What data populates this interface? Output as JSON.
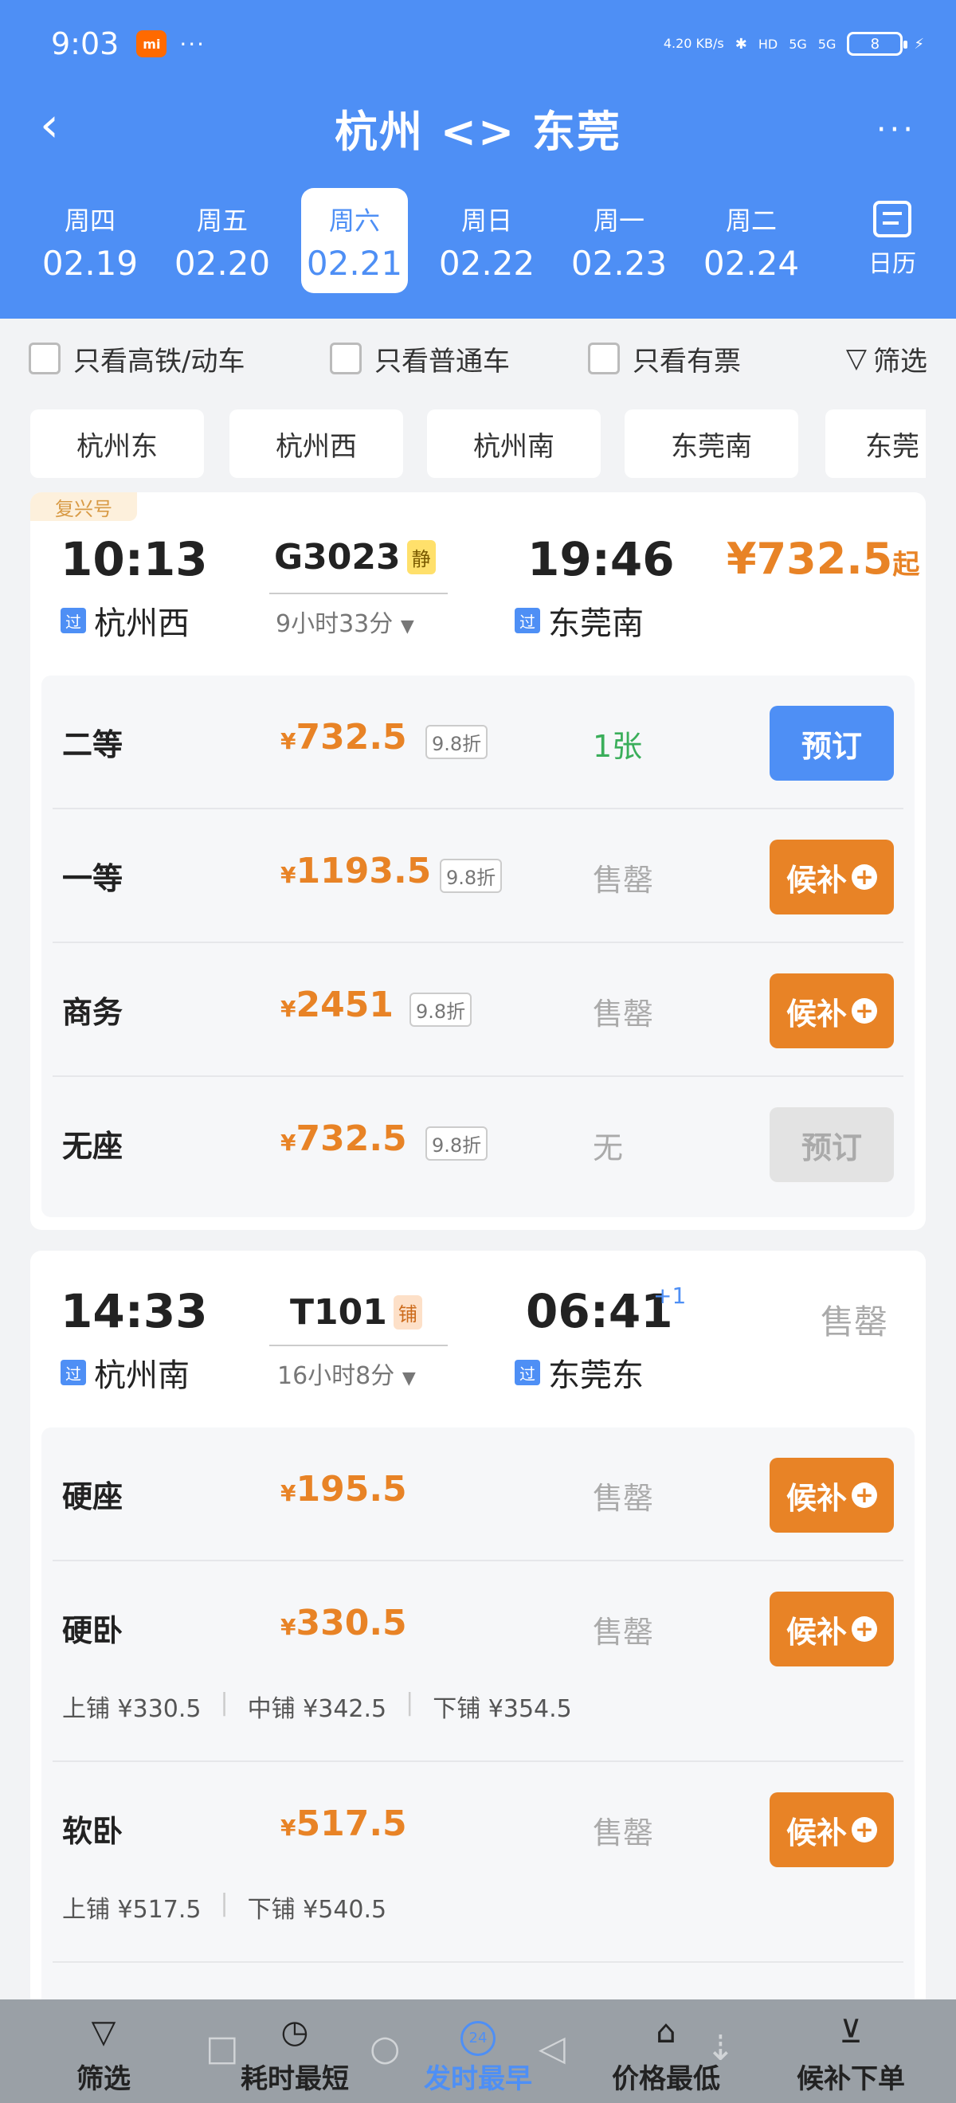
{
  "status": {
    "time": "9:03",
    "mi": "mi",
    "dots": "···",
    "net": "4.20 KB/s",
    "hd": "HD",
    "sig1": "5G",
    "sig2": "5G",
    "battery": "8"
  },
  "header": {
    "title": "杭州 <> 东莞",
    "back": "‹",
    "more": "···"
  },
  "dates": [
    {
      "wd": "周四",
      "dt": "02.19"
    },
    {
      "wd": "周五",
      "dt": "02.20"
    },
    {
      "wd": "周六",
      "dt": "02.21"
    },
    {
      "wd": "周日",
      "dt": "02.22"
    },
    {
      "wd": "周一",
      "dt": "02.23"
    },
    {
      "wd": "周二",
      "dt": "02.24"
    }
  ],
  "calendar_label": "日历",
  "filters": {
    "gaotie": "只看高铁/动车",
    "putong": "只看普通车",
    "youpiao": "只看有票",
    "shaixuan": "筛选"
  },
  "stations": [
    "杭州东",
    "杭州西",
    "杭州南",
    "东莞南",
    "东莞"
  ],
  "trains": [
    {
      "tag": "复兴号",
      "dep_time": "10:13",
      "dep_station": "杭州西",
      "guo": "过",
      "train_no": "G3023",
      "badge": "静",
      "duration": "9小时33分",
      "arr_time": "19:46",
      "arr_station": "东莞南",
      "from_price": "¥732.5",
      "from_suffix": "起",
      "seats": [
        {
          "name": "二等",
          "price": "732.5",
          "disc": "9.8折",
          "avail": "1张",
          "action": "预订"
        },
        {
          "name": "一等",
          "price": "1193.5",
          "disc": "9.8折",
          "avail": "售罄",
          "action": "候补"
        },
        {
          "name": "商务",
          "price": "2451",
          "disc": "9.8折",
          "avail": "售罄",
          "action": "候补"
        },
        {
          "name": "无座",
          "price": "732.5",
          "disc": "9.8折",
          "avail": "无",
          "action": "预订"
        }
      ]
    },
    {
      "dep_time": "14:33",
      "dep_station": "杭州南",
      "guo": "过",
      "train_no": "T101",
      "badge": "铺",
      "duration": "16小时8分",
      "arr_time": "06:41",
      "arr_plus": "+1",
      "arr_station": "东莞东",
      "status": "售罄",
      "seats": [
        {
          "name": "硬座",
          "price": "195.5",
          "avail": "售罄",
          "action": "候补"
        },
        {
          "name": "硬卧",
          "price": "330.5",
          "avail": "售罄",
          "action": "候补",
          "berths": [
            "上铺 ¥330.5",
            "中铺 ¥342.5",
            "下铺 ¥354.5"
          ]
        },
        {
          "name": "软卧",
          "price": "517.5",
          "avail": "售罄",
          "action": "候补",
          "berths": [
            "上铺 ¥517.5",
            "下铺 ¥540.5"
          ]
        }
      ]
    }
  ],
  "bottom": [
    {
      "label": "筛选",
      "icon": "filter-icon"
    },
    {
      "label": "耗时最短",
      "icon": "clock-icon"
    },
    {
      "label": "发时最早",
      "icon": "departure-24-icon",
      "badge": "24"
    },
    {
      "label": "价格最低",
      "icon": "price-tag-icon"
    },
    {
      "label": "候补下单",
      "icon": "waitlist-icon"
    }
  ],
  "colors": {
    "primary": "#4e8ff5",
    "orange": "#e88326",
    "green": "#3aae5a"
  }
}
